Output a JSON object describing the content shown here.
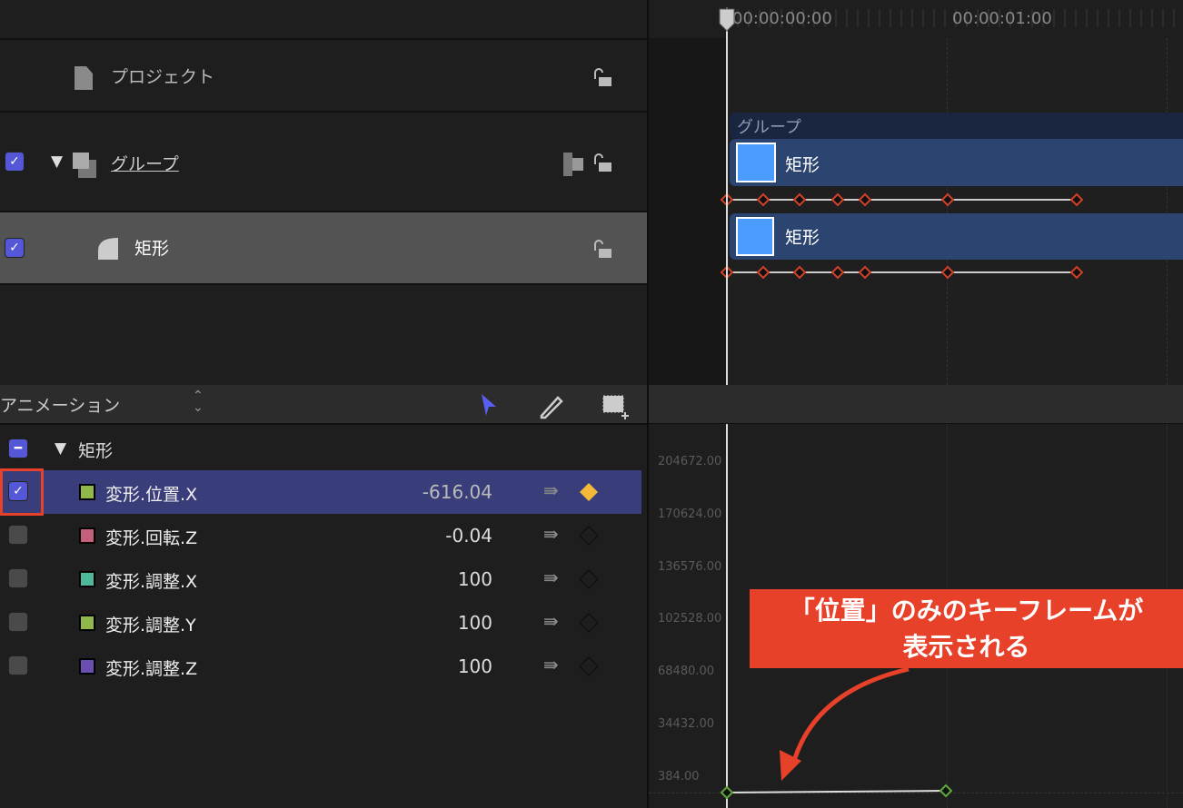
{
  "layers": {
    "project": {
      "label": "プロジェクト"
    },
    "group": {
      "label": "グループ",
      "checked": true
    },
    "rect": {
      "label": "矩形",
      "checked": true
    }
  },
  "animation": {
    "menu_label": "アニメーション",
    "group_label": "矩形",
    "params": [
      {
        "label": "変形.位置.X",
        "value": "-616.04",
        "checked": true,
        "color": "#8fb84a",
        "selected": true,
        "keyframe": "filled"
      },
      {
        "label": "変形.回転.Z",
        "value": "-0.04",
        "checked": false,
        "color": "#c4607a",
        "keyframe": "empty"
      },
      {
        "label": "変形.調整.X",
        "value": "100",
        "checked": false,
        "color": "#4fb89a",
        "keyframe": "empty"
      },
      {
        "label": "変形.調整.Y",
        "value": "100",
        "checked": false,
        "color": "#8fb84a",
        "keyframe": "empty"
      },
      {
        "label": "変形.調整.Z",
        "value": "100",
        "checked": false,
        "color": "#6a4fb0",
        "keyframe": "empty"
      }
    ]
  },
  "timeline": {
    "timecodes": [
      "00:00:00:00",
      "00:00:01:00"
    ],
    "group_bar": "グループ",
    "tracks": [
      "矩形",
      "矩形"
    ]
  },
  "graph": {
    "y_labels": [
      "204672.00",
      "170624.00",
      "136576.00",
      "102528.00",
      "68480.00",
      "34432.00",
      "384.00"
    ]
  },
  "callout": {
    "line1": "「位置」のみのキーフレームが",
    "line2": "表示される"
  },
  "colors": {
    "accent": "#5457d6",
    "keyframe_red": "#d0402a",
    "callout": "#e8412a",
    "selected_row": "#393e7a"
  }
}
